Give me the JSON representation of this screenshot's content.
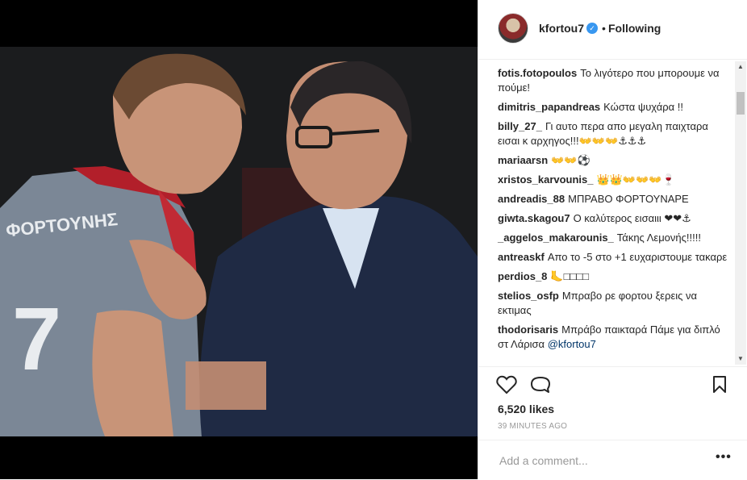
{
  "post": {
    "username": "kfortou7",
    "follow_status": "Following",
    "separator": "•",
    "verified_glyph": "✓",
    "likes": "6,520 likes",
    "time_ago": "39 MINUTES AGO",
    "add_comment_placeholder": "Add a comment...",
    "more_label": "•••",
    "jersey_name": "ΦΟΡΤΟΥΝΗΣ",
    "jersey_number": "7"
  },
  "comments": [
    {
      "user": "fotis.fotopoulos",
      "text": "Το λιγότερο που μπορουμε να πούμε!"
    },
    {
      "user": "dimitris_papandreas",
      "text": "Κώστα ψυχάρα !!"
    },
    {
      "user": "billy_27_",
      "text": "Γι αυτο περα απο μεγαλη παιχταρα εισαι κ αρχηγος!!!👐👐👐⚓⚓⚓"
    },
    {
      "user": "mariaarsn",
      "text": "👐👐⚽"
    },
    {
      "user": "xristos_karvounis_",
      "text": "👑👑👐👐👐🍷"
    },
    {
      "user": "andreadis_88",
      "text": "ΜΠΡΑΒΟ ΦΟΡΤΟΥΝΑΡΕ"
    },
    {
      "user": "giwta.skagou7",
      "text": "Ο καλύτερος εισαιιι ❤❤⚓"
    },
    {
      "user": "_aggelos_makarounis_",
      "text": "Τάκης Λεμονής!!!!!"
    },
    {
      "user": "antreaskf",
      "text": "Απο το -5 στο +1 ευχαριστουμε τακαρε"
    },
    {
      "user": "perdios_8",
      "text": "🦶□□□□"
    },
    {
      "user": "stelios_osfp",
      "text": "Μπραβο ρε φορτου ξερεις να εκτιμας"
    },
    {
      "user": "thodorisaris",
      "text": "Μπράβο παικταρά Πάμε για διπλό στ Λάρισα",
      "mention": "@kfortou7"
    }
  ],
  "icons": {
    "heart": "heart-icon",
    "comment": "comment-icon",
    "bookmark": "bookmark-icon",
    "verified": "verified-badge-icon"
  },
  "colors": {
    "verified": "#3897f0",
    "mention": "#003569",
    "jersey": "#7b8796",
    "suit": "#1f2a44"
  }
}
